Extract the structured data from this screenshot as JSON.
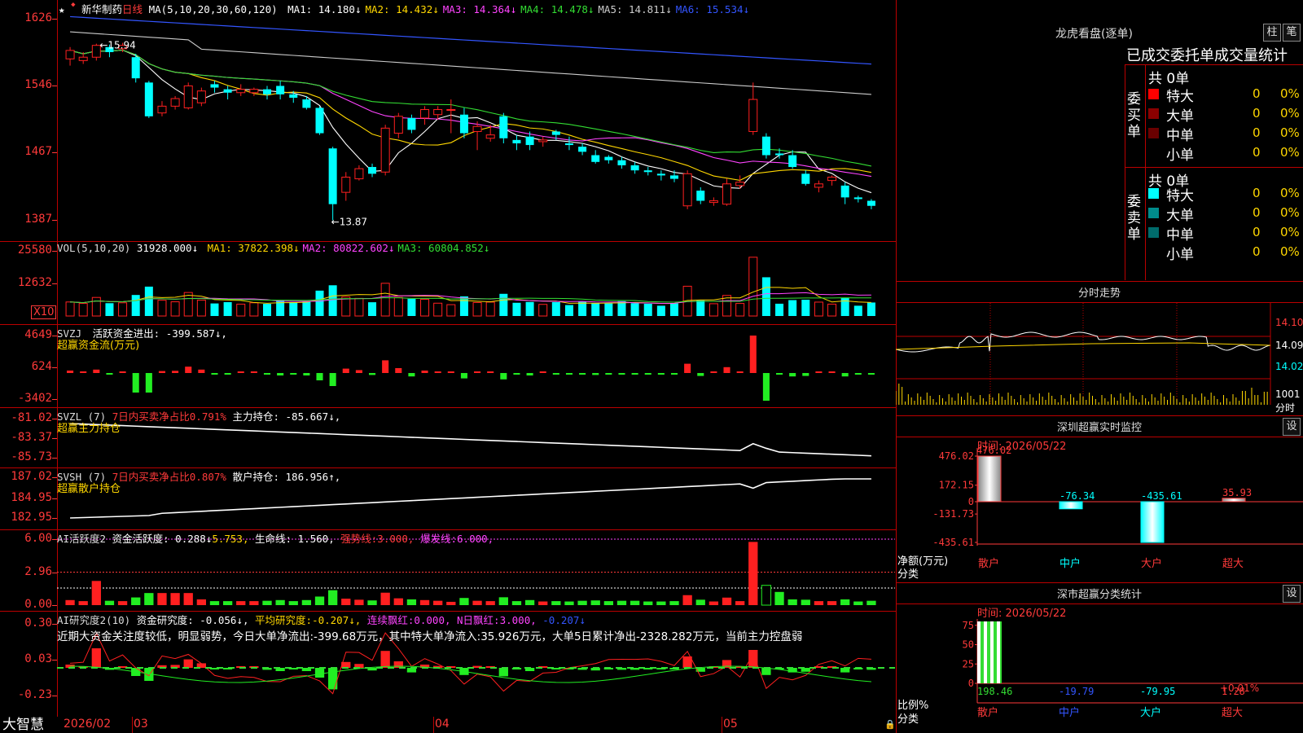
{
  "main": {
    "title": "新华制药",
    "period": "日线",
    "ma_header": "MA(5,10,20,30,60,120)",
    "ma": [
      {
        "label": "MA1:",
        "value": "14.180↓",
        "color": "#ffffff"
      },
      {
        "label": "MA2:",
        "value": "14.432↓",
        "color": "#ffd700"
      },
      {
        "label": "MA3:",
        "value": "14.364↓",
        "color": "#ff44ff"
      },
      {
        "label": "MA4:",
        "value": "14.478↓",
        "color": "#33dd33"
      },
      {
        "label": "MA5:",
        "value": "14.811↓",
        "color": "#cccccc"
      },
      {
        "label": "MA6:",
        "value": "15.534↓",
        "color": "#3355ff"
      }
    ],
    "yticks": [
      "1626",
      "1546",
      "1467",
      "1387"
    ],
    "high_label": "15.94",
    "low_label": "13.87"
  },
  "vol": {
    "header": "VOL(5,10,20)",
    "value": "31928.000↓",
    "ma": [
      {
        "label": "MA1:",
        "value": "37822.398↓",
        "color": "#ffd700"
      },
      {
        "label": "MA2:",
        "value": "80822.602↓",
        "color": "#ff44ff"
      },
      {
        "label": "MA3:",
        "value": "60804.852↓",
        "color": "#33dd33"
      }
    ],
    "yticks": [
      "25580",
      "12632"
    ],
    "unit": "X10"
  },
  "svzj": {
    "header": "SVZJ",
    "label": "活跃资金进出:",
    "value": "-399.587↓,",
    "sub": "超赢资金流(万元)",
    "yticks": [
      "4649",
      "624",
      "-3402"
    ]
  },
  "svzl": {
    "header": "SVZL (7)",
    "ratio": "7日内买卖净占比0.791%",
    "label": "主力持仓:",
    "value": "-85.667↓,",
    "sub": "超赢主力持仓",
    "yticks": [
      "-81.02",
      "-83.37",
      "-85.73"
    ]
  },
  "svsh": {
    "header": "SVSH (7)",
    "ratio": "7日内买卖净占比0.807%",
    "label": "散户持仓:",
    "value": "186.956↑,",
    "sub": "超赢散户持仓",
    "yticks": [
      "187.02",
      "184.95",
      "182.95"
    ]
  },
  "ai1": {
    "header": "AI活跃度2",
    "l1": "资金活跃度:",
    "v1": "0.288↓",
    "v2": "5.753,",
    "l3": "生命线:",
    "v3": "1.560,",
    "l4": "强势线:",
    "v4": "3.000,",
    "l5": "爆发线:",
    "v5": "6.000,",
    "yticks": [
      "6.00",
      "2.96",
      "0.00"
    ]
  },
  "ai2": {
    "header": "AI研究度2(10)",
    "l1": "资金研究度:",
    "v1": "-0.056↓,",
    "l2": "平均研究度:",
    "v2": "-0.207↓,",
    "l3": "连续飘红:",
    "v3": "0.000,",
    "l4": "N日飘红:",
    "v4": "3.000,",
    "v5": "-0.207↓",
    "comment": "近期大资金关注度较低，明显弱势，今日大单净流出:-399.68万元，其中特大单净流入:35.926万元，大单5日累计净出-2328.282万元，当前主力控盘弱",
    "yticks": [
      "0.30",
      "0.03",
      "-0.23"
    ]
  },
  "xaxis": {
    "labels": [
      "2026/02",
      "03",
      "04",
      "05"
    ]
  },
  "brand": "大智慧",
  "lhb": {
    "title": "龙虎看盘(逐单)",
    "btn1": "柱",
    "btn2": "笔",
    "tabs": "已成交委托单成交量统计",
    "buy_label": "委买单",
    "sell_label": "委卖单",
    "buy_total": "共 0单",
    "sell_total": "共 0单",
    "buy_rows": [
      {
        "name": "特大",
        "count": "0",
        "pct": "0%",
        "color": "#ff0000"
      },
      {
        "name": "大单",
        "count": "0",
        "pct": "0%",
        "color": "#8b0000"
      },
      {
        "name": "中单",
        "count": "0",
        "pct": "0%",
        "color": "#6a0000"
      },
      {
        "name": "小单",
        "count": "0",
        "pct": "0%",
        "color": "#000000"
      }
    ],
    "sell_rows": [
      {
        "name": "特大",
        "count": "0",
        "pct": "0%",
        "color": "#00ffff"
      },
      {
        "name": "大单",
        "count": "0",
        "pct": "0%",
        "color": "#008b8b"
      },
      {
        "name": "中单",
        "count": "0",
        "pct": "0%",
        "color": "#006b6b"
      },
      {
        "name": "小单",
        "count": "0",
        "pct": "0%",
        "color": "#000000"
      }
    ]
  },
  "fenshi": {
    "title": "分时走势",
    "price_labels": [
      "14.10",
      "14.09",
      "14.02"
    ],
    "vol_label": "1001",
    "vol_unit": "分时"
  },
  "monitor": {
    "title": "深圳超赢实时监控",
    "btn": "设",
    "date": "时间: 2026/05/22",
    "yticks": [
      "476.02",
      "172.15",
      "0",
      "-131.73",
      "-435.61"
    ],
    "ylabel": "净额(万元)",
    "cat_label": "分类",
    "bars": [
      {
        "cat": "散户",
        "value": 476.02,
        "label": "476.02",
        "label_color": "#ff3a3a",
        "cat_color": "#ff3a3a"
      },
      {
        "cat": "中户",
        "value": -76.34,
        "label": "-76.34",
        "label_color": "#00ffff",
        "cat_color": "#00ffff"
      },
      {
        "cat": "大户",
        "value": -435.61,
        "label": "-435.61",
        "label_color": "#00ffff",
        "cat_color": "#ff3a3a"
      },
      {
        "cat": "超大",
        "value": 35.93,
        "label": "35.93",
        "label_color": "#ff3a3a",
        "cat_color": "#ff3a3a"
      }
    ]
  },
  "stats": {
    "title": "深市超赢分类统计",
    "btn": "设",
    "date": "时间: 2026/05/22",
    "yticks": [
      "75",
      "50",
      "25",
      "0"
    ],
    "ylabel": "比例%",
    "cat_label": "分类",
    "annotation": "+0.01%",
    "bars": [
      {
        "cat": "散户",
        "value": "198.46",
        "cat_color": "#ff3a3a",
        "val_color": "#33dd33"
      },
      {
        "cat": "中户",
        "value": "-19.79",
        "cat_color": "#3355ff",
        "val_color": "#3355ff"
      },
      {
        "cat": "大户",
        "value": "-79.95",
        "cat_color": "#00ffff",
        "val_color": "#00ffff"
      },
      {
        "cat": "超大",
        "value": "1.28",
        "cat_color": "#ff3a3a",
        "val_color": "#ff3a3a"
      }
    ]
  },
  "chart_data": {
    "type": "candlestick",
    "title": "新华制药 日线",
    "ylim": [
      13.87,
      16.26
    ],
    "candles": [
      {
        "o": 15.78,
        "c": 15.88,
        "h": 15.92,
        "l": 15.7
      },
      {
        "o": 15.76,
        "c": 15.8,
        "h": 15.86,
        "l": 15.72
      },
      {
        "o": 15.8,
        "c": 15.94,
        "h": 15.96,
        "l": 15.76
      },
      {
        "o": 15.92,
        "c": 15.86,
        "h": 15.95,
        "l": 15.8
      },
      {
        "o": 15.9,
        "c": 15.94,
        "h": 15.97,
        "l": 15.86
      },
      {
        "o": 15.8,
        "c": 15.55,
        "h": 15.84,
        "l": 15.5
      },
      {
        "o": 15.5,
        "c": 15.1,
        "h": 15.52,
        "l": 15.08
      },
      {
        "o": 15.14,
        "c": 15.22,
        "h": 15.28,
        "l": 15.1
      },
      {
        "o": 15.22,
        "c": 15.31,
        "h": 15.34,
        "l": 15.18
      },
      {
        "o": 15.2,
        "c": 15.46,
        "h": 15.5,
        "l": 15.18
      },
      {
        "o": 15.26,
        "c": 15.4,
        "h": 15.44,
        "l": 15.22
      },
      {
        "o": 15.48,
        "c": 15.44,
        "h": 15.52,
        "l": 15.38
      },
      {
        "o": 15.42,
        "c": 15.38,
        "h": 15.46,
        "l": 15.3
      },
      {
        "o": 15.38,
        "c": 15.42,
        "h": 15.48,
        "l": 15.34
      },
      {
        "o": 15.38,
        "c": 15.42,
        "h": 15.44,
        "l": 15.34
      },
      {
        "o": 15.42,
        "c": 15.36,
        "h": 15.46,
        "l": 15.3
      },
      {
        "o": 15.46,
        "c": 15.36,
        "h": 15.52,
        "l": 15.3
      },
      {
        "o": 15.36,
        "c": 15.32,
        "h": 15.4,
        "l": 15.26
      },
      {
        "o": 15.3,
        "c": 15.2,
        "h": 15.34,
        "l": 15.18
      },
      {
        "o": 15.2,
        "c": 14.9,
        "h": 15.22,
        "l": 14.88
      },
      {
        "o": 14.72,
        "c": 14.06,
        "h": 14.74,
        "l": 13.87
      },
      {
        "o": 14.2,
        "c": 14.38,
        "h": 14.44,
        "l": 14.1
      },
      {
        "o": 14.36,
        "c": 14.48,
        "h": 14.52,
        "l": 14.34
      },
      {
        "o": 14.5,
        "c": 14.42,
        "h": 14.54,
        "l": 14.38
      },
      {
        "o": 14.44,
        "c": 14.96,
        "h": 15.0,
        "l": 14.4
      },
      {
        "o": 14.9,
        "c": 15.1,
        "h": 15.14,
        "l": 14.84
      },
      {
        "o": 15.08,
        "c": 14.94,
        "h": 15.12,
        "l": 14.9
      },
      {
        "o": 15.08,
        "c": 15.18,
        "h": 15.22,
        "l": 15.0
      },
      {
        "o": 15.12,
        "c": 15.18,
        "h": 15.22,
        "l": 15.06
      },
      {
        "o": 15.18,
        "c": 15.18,
        "h": 15.3,
        "l": 14.9
      },
      {
        "o": 15.12,
        "c": 14.9,
        "h": 15.2,
        "l": 14.84
      },
      {
        "o": 14.92,
        "c": 14.98,
        "h": 15.04,
        "l": 14.7
      },
      {
        "o": 14.84,
        "c": 14.88,
        "h": 15.0,
        "l": 14.8
      },
      {
        "o": 15.1,
        "c": 14.84,
        "h": 15.14,
        "l": 14.78
      },
      {
        "o": 14.82,
        "c": 14.78,
        "h": 14.88,
        "l": 14.7
      },
      {
        "o": 14.86,
        "c": 14.76,
        "h": 14.92,
        "l": 14.7
      },
      {
        "o": 14.8,
        "c": 14.82,
        "h": 14.86,
        "l": 14.74
      },
      {
        "o": 14.92,
        "c": 14.88,
        "h": 14.94,
        "l": 14.82
      },
      {
        "o": 14.78,
        "c": 14.76,
        "h": 14.86,
        "l": 14.7
      },
      {
        "o": 14.74,
        "c": 14.68,
        "h": 14.78,
        "l": 14.64
      },
      {
        "o": 14.64,
        "c": 14.56,
        "h": 14.7,
        "l": 14.54
      },
      {
        "o": 14.62,
        "c": 14.58,
        "h": 14.64,
        "l": 14.54
      },
      {
        "o": 14.58,
        "c": 14.52,
        "h": 14.62,
        "l": 14.48
      },
      {
        "o": 14.52,
        "c": 14.46,
        "h": 14.56,
        "l": 14.42
      },
      {
        "o": 14.46,
        "c": 14.44,
        "h": 14.5,
        "l": 14.4
      },
      {
        "o": 14.42,
        "c": 14.4,
        "h": 14.46,
        "l": 14.34
      },
      {
        "o": 14.4,
        "c": 14.36,
        "h": 14.46,
        "l": 14.32
      },
      {
        "o": 14.04,
        "c": 14.42,
        "h": 14.46,
        "l": 14.0
      },
      {
        "o": 14.22,
        "c": 14.1,
        "h": 14.26,
        "l": 14.06
      },
      {
        "o": 14.08,
        "c": 14.1,
        "h": 14.14,
        "l": 14.04
      },
      {
        "o": 14.06,
        "c": 14.3,
        "h": 14.36,
        "l": 14.04
      },
      {
        "o": 14.28,
        "c": 14.32,
        "h": 14.4,
        "l": 14.24
      },
      {
        "o": 14.92,
        "c": 15.3,
        "h": 15.5,
        "l": 14.88
      },
      {
        "o": 14.86,
        "c": 14.64,
        "h": 14.9,
        "l": 14.6
      },
      {
        "o": 14.66,
        "c": 14.64,
        "h": 14.72,
        "l": 14.6
      },
      {
        "o": 14.64,
        "c": 14.5,
        "h": 14.7,
        "l": 14.48
      },
      {
        "o": 14.42,
        "c": 14.3,
        "h": 14.46,
        "l": 14.28
      },
      {
        "o": 14.26,
        "c": 14.3,
        "h": 14.34,
        "l": 14.2
      },
      {
        "o": 14.34,
        "c": 14.38,
        "h": 14.4,
        "l": 14.28
      },
      {
        "o": 14.28,
        "c": 14.14,
        "h": 14.32,
        "l": 14.06
      },
      {
        "o": 14.14,
        "c": 14.12,
        "h": 14.16,
        "l": 14.08
      },
      {
        "o": 14.1,
        "c": 14.04,
        "h": 14.12,
        "l": 14.0
      }
    ]
  }
}
